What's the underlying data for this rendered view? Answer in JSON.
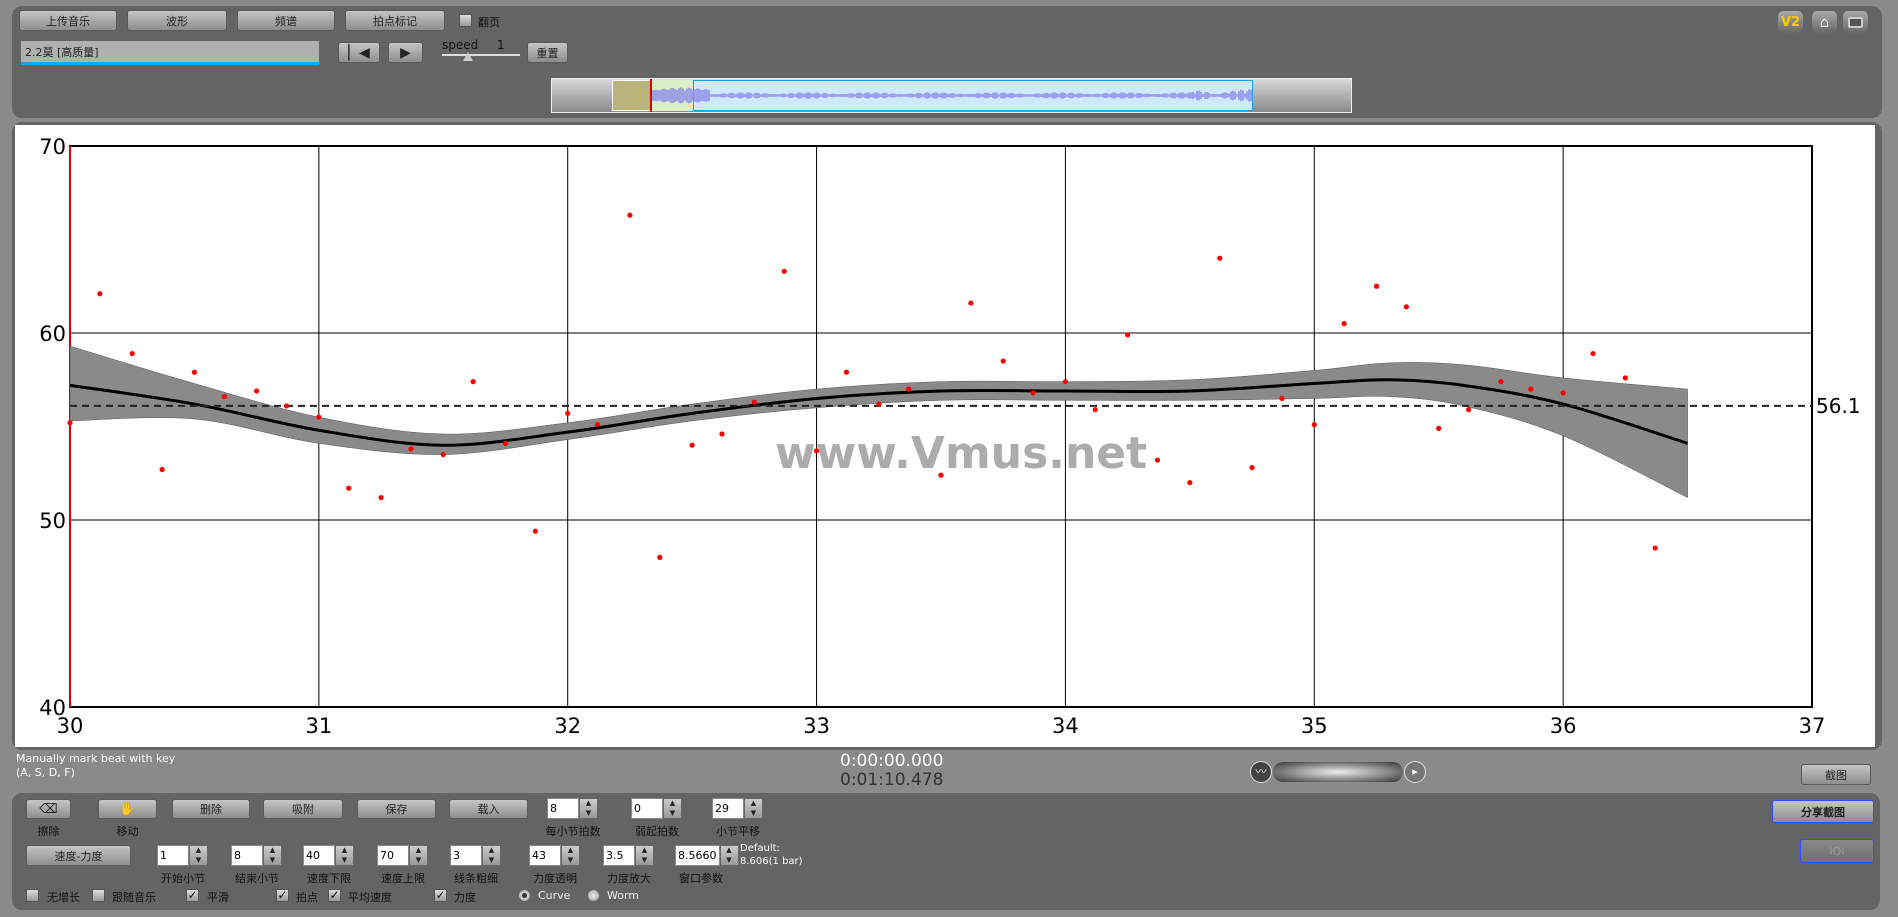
{
  "toolbar": {
    "buttons": [
      "上传音乐",
      "波形",
      "频谱",
      "拍点标记"
    ],
    "page_flip_label": "翻页",
    "page_flip_checked": false,
    "track_name": "2.2莫 [高质量]",
    "speed_label": "speed",
    "speed_value": "1",
    "reset_label": "重置",
    "icons": {
      "version": "V2",
      "home": "home-icon",
      "fullscreen": "fullscreen-icon"
    }
  },
  "waveform": {
    "selection_color": "#cfeaff",
    "wave_color": "#8888ee",
    "marker_color": "#dd0000"
  },
  "chart_data": {
    "type": "scatter",
    "xlim": [
      30,
      37
    ],
    "ylim": [
      40,
      70
    ],
    "xticks": [
      "30",
      "31",
      "32",
      "33",
      "34",
      "35",
      "36",
      "37"
    ],
    "yticks": [
      "40",
      "50",
      "60",
      "70"
    ],
    "grid": true,
    "points_color": "#ff0000",
    "points": [
      [
        30.0,
        55.2
      ],
      [
        30.12,
        62.1
      ],
      [
        30.25,
        58.9
      ],
      [
        30.37,
        52.7
      ],
      [
        30.5,
        57.9
      ],
      [
        30.62,
        56.6
      ],
      [
        30.75,
        56.9
      ],
      [
        30.87,
        56.1
      ],
      [
        31.0,
        55.5
      ],
      [
        31.12,
        51.7
      ],
      [
        31.25,
        51.2
      ],
      [
        31.37,
        53.8
      ],
      [
        31.5,
        53.5
      ],
      [
        31.62,
        57.4
      ],
      [
        31.75,
        54.1
      ],
      [
        31.87,
        49.4
      ],
      [
        32.0,
        55.7
      ],
      [
        32.12,
        55.1
      ],
      [
        32.25,
        66.3
      ],
      [
        32.37,
        48.0
      ],
      [
        32.5,
        54.0
      ],
      [
        32.62,
        54.6
      ],
      [
        32.75,
        56.3
      ],
      [
        32.87,
        63.3
      ],
      [
        33.0,
        53.7
      ],
      [
        33.12,
        57.9
      ],
      [
        33.25,
        56.2
      ],
      [
        33.37,
        57.0
      ],
      [
        33.5,
        52.4
      ],
      [
        33.62,
        61.6
      ],
      [
        33.75,
        58.5
      ],
      [
        33.87,
        56.8
      ],
      [
        34.0,
        57.4
      ],
      [
        34.12,
        55.9
      ],
      [
        34.25,
        59.9
      ],
      [
        34.37,
        53.2
      ],
      [
        34.5,
        52.0
      ],
      [
        34.62,
        64.0
      ],
      [
        34.75,
        52.8
      ],
      [
        34.87,
        56.5
      ],
      [
        35.0,
        55.1
      ],
      [
        35.12,
        60.5
      ],
      [
        35.25,
        62.5
      ],
      [
        35.37,
        61.4
      ],
      [
        35.5,
        54.9
      ],
      [
        35.62,
        55.9
      ],
      [
        35.75,
        57.4
      ],
      [
        35.87,
        57.0
      ],
      [
        36.0,
        56.8
      ],
      [
        36.12,
        58.9
      ],
      [
        36.25,
        57.6
      ],
      [
        36.37,
        48.5
      ]
    ],
    "smooth": {
      "x": [
        30,
        30.5,
        31,
        31.5,
        32,
        32.5,
        33,
        33.5,
        34,
        34.5,
        35,
        35.3,
        35.6,
        36,
        36.5
      ],
      "y": [
        57.2,
        56.2,
        54.8,
        54.0,
        54.7,
        55.7,
        56.5,
        56.9,
        56.9,
        56.9,
        57.3,
        57.5,
        57.2,
        56.2,
        54.1
      ],
      "lower": [
        55.3,
        55.4,
        54.1,
        53.5,
        54.3,
        55.3,
        56.0,
        56.4,
        56.4,
        56.4,
        56.5,
        56.6,
        56.1,
        54.5,
        51.2
      ],
      "upper": [
        59.3,
        57.3,
        55.5,
        54.6,
        55.2,
        56.2,
        57.0,
        57.4,
        57.4,
        57.5,
        58.0,
        58.4,
        58.3,
        57.6,
        57.0
      ]
    },
    "mean_line": 56.1,
    "mean_label": "56.1"
  },
  "watermark": "www.Vmus.net",
  "status": {
    "hint_line1": "Manually mark beat with key",
    "hint_line2": "(A, S, D, F)",
    "time_current": "0:00:00.000",
    "time_total": "0:01:10.478",
    "screenshot": "截图"
  },
  "controls": {
    "row1_buttons": [
      "删除",
      "吸附",
      "保存",
      "载入"
    ],
    "erase_label": "擦除",
    "move_label": "移动",
    "spin1": [
      {
        "value": "8",
        "label": "每小节拍数"
      },
      {
        "value": "0",
        "label": "弱起拍数"
      },
      {
        "value": "29",
        "label": "小节平移"
      }
    ],
    "tempo_dyn": "速度-力度",
    "spin2": [
      {
        "value": "1",
        "label": "开始小节"
      },
      {
        "value": "8",
        "label": "结束小节"
      },
      {
        "value": "40",
        "label": "速度下限"
      },
      {
        "value": "70",
        "label": "速度上限"
      },
      {
        "value": "3",
        "label": "线条粗细"
      },
      {
        "value": "43",
        "label": "力度透明"
      },
      {
        "value": "3.5",
        "label": "力度放大"
      },
      {
        "value": "8.5660",
        "label": "窗口参数"
      }
    ],
    "default_line1": "Default:",
    "default_line2": "8.606(1 bar)",
    "checks": [
      {
        "label": "无增长",
        "checked": false
      },
      {
        "label": "跟随音乐",
        "checked": false
      },
      {
        "label": "平滑",
        "checked": true
      },
      {
        "label": "拍点",
        "checked": true
      },
      {
        "label": "平均速度",
        "checked": true
      },
      {
        "label": "力度",
        "checked": true
      }
    ],
    "radios": [
      {
        "label": "Curve",
        "checked": true
      },
      {
        "label": "Worm",
        "checked": false
      }
    ],
    "share": "分享截图",
    "ioi": "IOI"
  }
}
